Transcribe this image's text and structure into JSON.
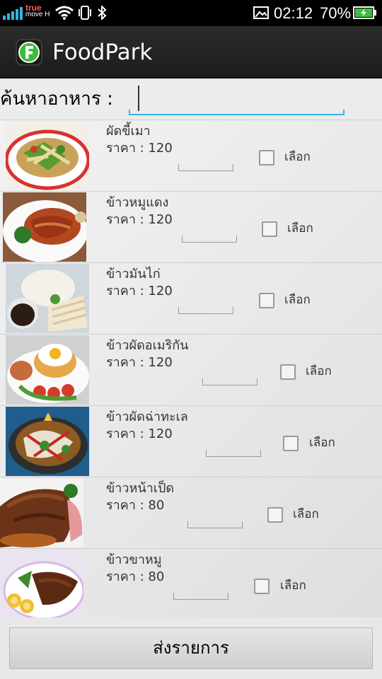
{
  "status_bar": {
    "carrier_line1": "true",
    "carrier_line2": "move H",
    "time": "02:12",
    "battery": "70%",
    "icons": [
      "signal-icon",
      "wifi-icon",
      "vibrate-icon",
      "bluetooth-icon",
      "screenshot-icon",
      "battery-charging-icon"
    ]
  },
  "app": {
    "title": "FoodPark",
    "icon": "foodpark-logo-icon",
    "icon_letter": "F"
  },
  "search": {
    "label": "ค้นหาอาหาร :",
    "value": ""
  },
  "food_items": [
    {
      "name": "ผัดขี้เมา",
      "price": "ราคา : 120",
      "select_label": "เลือก",
      "checked": false
    },
    {
      "name": "ข้าวหมูแดง",
      "price": "ราคา : 120",
      "select_label": "เลือก",
      "checked": false
    },
    {
      "name": "ข้าวมันไก่",
      "price": "ราคา : 120",
      "select_label": "เลือก",
      "checked": false
    },
    {
      "name": "ข้าวผัดอเมริกัน",
      "price": "ราคา : 120",
      "select_label": "เลือก",
      "checked": false
    },
    {
      "name": "ข้าวผัดฉ่าทะเล",
      "price": "ราคา : 120",
      "select_label": "เลือก",
      "checked": false
    },
    {
      "name": "ข้าวหน้าเป็ด",
      "price": "ราคา : 80",
      "select_label": "เลือก",
      "checked": false
    },
    {
      "name": "ข้าวขาหมู",
      "price": "ราคา : 80",
      "select_label": "เลือก",
      "checked": false
    }
  ],
  "submit_label": "ส่งรายการ",
  "colors": {
    "accent": "#33b5e5",
    "action_bar": "#222222",
    "logo_green": "#3dbb3d"
  }
}
